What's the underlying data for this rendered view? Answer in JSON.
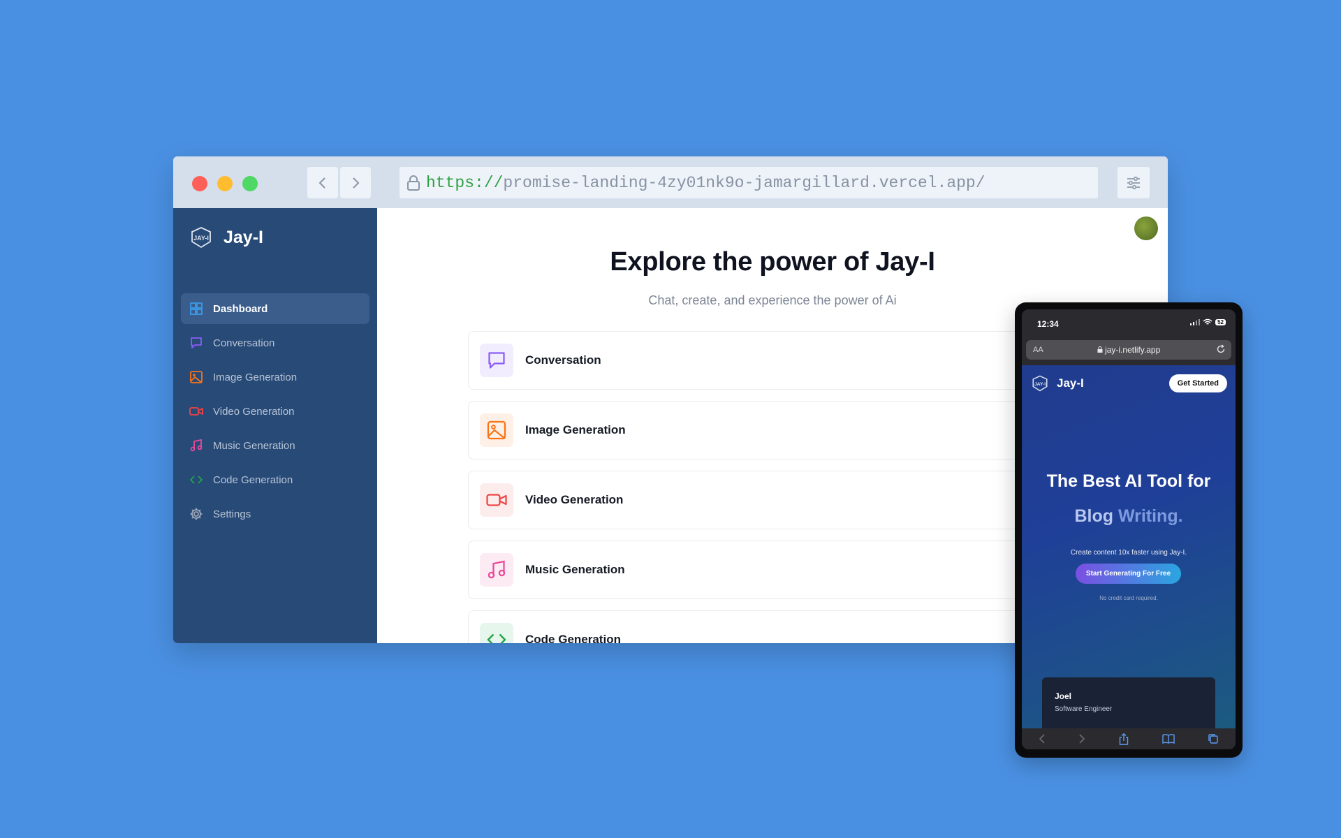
{
  "browser": {
    "url_scheme": "https://",
    "url_rest": "promise-landing-4zy01nk9o-jamargillard.vercel.app/"
  },
  "sidebar": {
    "brand": "Jay-I",
    "items": [
      {
        "label": "Dashboard",
        "icon": "dashboard-icon",
        "color": "#3b9be8",
        "active": true
      },
      {
        "label": "Conversation",
        "icon": "chat-icon",
        "color": "#8b5cf6"
      },
      {
        "label": "Image Generation",
        "icon": "image-icon",
        "color": "#f97316"
      },
      {
        "label": "Video Generation",
        "icon": "video-icon",
        "color": "#ef4444"
      },
      {
        "label": "Music Generation",
        "icon": "music-icon",
        "color": "#ec4899"
      },
      {
        "label": "Code Generation",
        "icon": "code-icon",
        "color": "#22a447"
      },
      {
        "label": "Settings",
        "icon": "gear-icon",
        "color": "#9aa7b8"
      }
    ]
  },
  "main": {
    "title": "Explore the power of Jay-I",
    "subtitle": "Chat, create, and experience the power of Ai",
    "cards": [
      {
        "label": "Conversation",
        "icon": "chat-icon",
        "color": "#8b5cf6",
        "bg": "#f1ecfe"
      },
      {
        "label": "Image Generation",
        "icon": "image-icon",
        "color": "#f97316",
        "bg": "#fef0e6"
      },
      {
        "label": "Video Generation",
        "icon": "video-icon",
        "color": "#ef4444",
        "bg": "#fdecec"
      },
      {
        "label": "Music Generation",
        "icon": "music-icon",
        "color": "#ec4899",
        "bg": "#fdebf4"
      },
      {
        "label": "Code Generation",
        "icon": "code-icon",
        "color": "#22a447",
        "bg": "#e7f6ec"
      }
    ]
  },
  "phone": {
    "time": "12:34",
    "battery": "52",
    "aa": "AA",
    "host": "jay-i.netlify.app",
    "brand": "Jay-I",
    "get_started": "Get Started",
    "headline_1": "The Best AI Tool for",
    "headline_2a": "Blog ",
    "headline_2b": "Writing.",
    "subtext": "Create content 10x faster using Jay-I.",
    "cta": "Start Generating For Free",
    "note": "No credit card required.",
    "testimonial": {
      "name": "Joel",
      "role": "Software Engineer"
    }
  }
}
